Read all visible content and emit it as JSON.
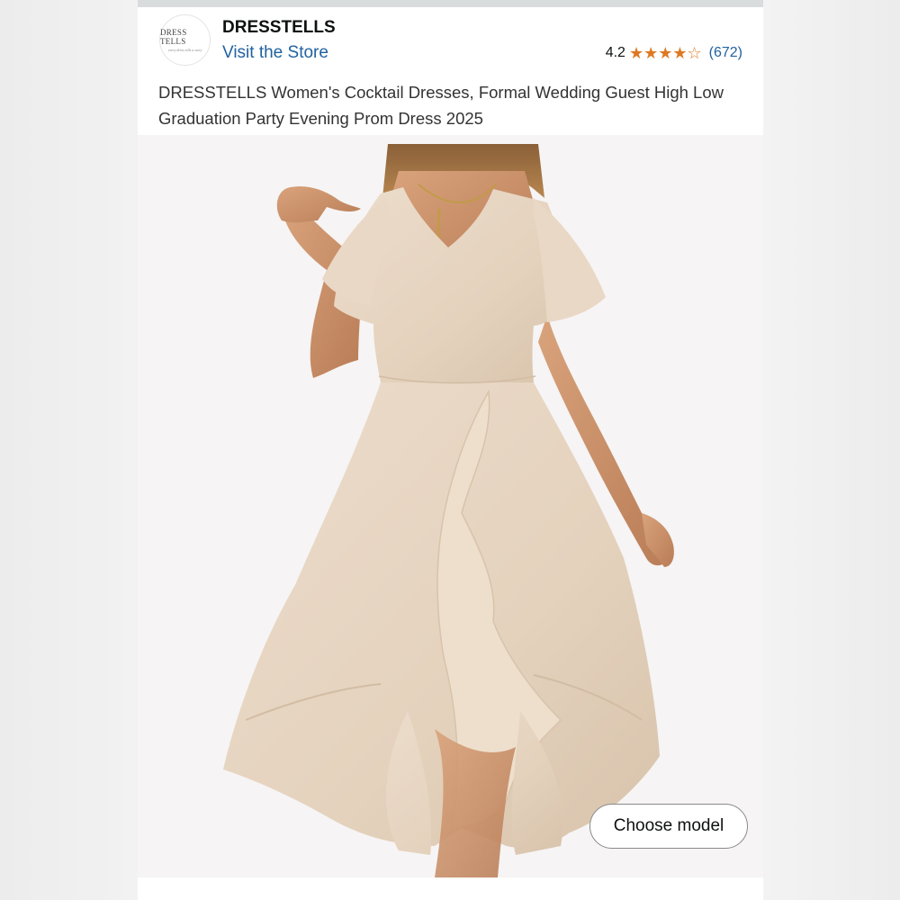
{
  "store": {
    "logo_text": "Dress Tells",
    "logo_tagline": "every dress tells a story",
    "brand_name": "DRESSTELLS",
    "visit_link": "Visit the Store"
  },
  "rating": {
    "value": "4.2",
    "stars_filled": 4,
    "stars_total": 5,
    "review_count": "(672)"
  },
  "product": {
    "title": "DRESSTELLS Women's Cocktail Dresses, Formal Wedding Guest High Low Graduation Party Evening Prom Dress 2025",
    "image_icon": "dress-product-photo",
    "dress_color": "#e6d5c1"
  },
  "actions": {
    "choose_model_label": "Choose model"
  },
  "colors": {
    "link": "#2162a1",
    "star": "#de7921",
    "text": "#0f1111"
  }
}
